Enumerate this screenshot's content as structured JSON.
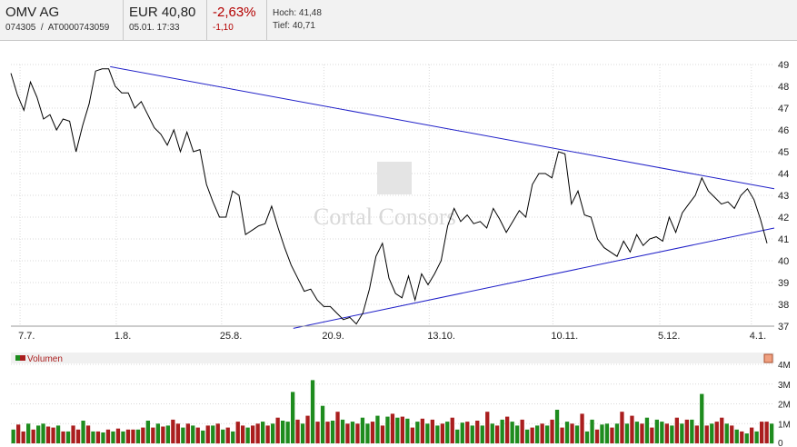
{
  "header": {
    "name": "OMV AG",
    "ids": "074305  /  AT0000743059",
    "price": "EUR 40,80",
    "datetime": "05.01. 17:33",
    "change_pct": "-2,63%",
    "change_abs": "-1,10",
    "high": "Hoch: 41,48",
    "low": "Tief: 40,71"
  },
  "watermark": "Cortal Consors",
  "colors": {
    "price_line": "#000000",
    "trend_line": "#2020c8",
    "vol_up": "#1e8c1e",
    "vol_down": "#aa1e1e",
    "grid": "#d9d9d9",
    "negative": "#b40000"
  },
  "chart_data": [
    {
      "type": "line",
      "x_tick_labels": [
        "7.7.",
        "1.8.",
        "25.8.",
        "20.9.",
        "13.10.",
        "10.11.",
        "5.12.",
        "4.1."
      ],
      "ylim": [
        37,
        49
      ],
      "y_ticks": [
        37,
        38,
        39,
        40,
        41,
        42,
        43,
        44,
        45,
        46,
        47,
        48,
        49
      ],
      "grid": true,
      "series": [
        {
          "values": [
            48.6,
            47.6,
            46.9,
            48.2,
            47.5,
            46.5,
            46.7,
            46.0,
            46.5,
            46.4,
            45.0,
            46.2,
            47.2,
            48.7,
            48.8,
            48.8,
            48.0,
            47.7,
            47.7,
            47.0,
            47.3,
            46.7,
            46.1,
            45.8,
            45.3,
            46.0,
            45.0,
            45.9,
            45.0,
            45.1,
            43.5,
            42.7,
            42.0,
            42.0,
            43.2,
            43.0,
            41.2,
            41.4,
            41.6,
            41.7,
            42.5,
            41.5,
            40.6,
            39.8,
            39.2,
            38.6,
            38.7,
            38.2,
            37.9,
            37.9,
            37.6,
            37.3,
            37.4,
            37.1,
            37.6,
            38.7,
            40.2,
            40.8,
            39.2,
            38.5,
            38.3,
            39.3,
            38.2,
            39.4,
            38.9,
            39.4,
            40.0,
            41.6,
            42.4,
            41.8,
            42.1,
            41.7,
            41.8,
            41.5,
            42.4,
            41.9,
            41.3,
            41.8,
            42.3,
            42.0,
            43.5,
            44.0,
            44.0,
            43.8,
            45.0,
            44.9,
            42.6,
            43.2,
            42.1,
            42.0,
            41.0,
            40.6,
            40.4,
            40.2,
            40.9,
            40.4,
            41.2,
            40.7,
            41.0,
            41.1,
            40.9,
            42.0,
            41.3,
            42.2,
            42.6,
            43.0,
            43.8,
            43.2,
            42.9,
            42.6,
            42.7,
            42.4,
            43.0,
            43.3,
            42.8,
            41.9,
            40.8
          ]
        }
      ],
      "trendlines": [
        {
          "from": [
            48.9,
            0.13
          ],
          "to": [
            43.3,
            1.0
          ]
        },
        {
          "from": [
            36.9,
            0.37
          ],
          "to": [
            41.5,
            1.0
          ]
        }
      ]
    },
    {
      "type": "bar",
      "title": "Volumen",
      "ylim": [
        0,
        4
      ],
      "y_tick_labels": [
        "0",
        "1M",
        "2M",
        "3M",
        "4M"
      ],
      "values": [
        0.7,
        0.95,
        0.6,
        1.0,
        0.7,
        0.9,
        1.0,
        0.85,
        0.8,
        0.9,
        0.6,
        0.6,
        0.9,
        0.7,
        1.15,
        0.9,
        0.6,
        0.6,
        0.55,
        0.7,
        0.6,
        0.75,
        0.6,
        0.7,
        0.7,
        0.7,
        0.8,
        1.15,
        0.8,
        1.0,
        0.85,
        0.9,
        1.2,
        1.0,
        0.8,
        1.0,
        0.9,
        0.8,
        0.65,
        0.9,
        0.9,
        1.0,
        0.7,
        0.8,
        0.6,
        1.1,
        0.9,
        0.8,
        0.9,
        1.0,
        1.1,
        0.9,
        1.0,
        1.3,
        1.15,
        1.1,
        2.6,
        1.2,
        1.0,
        1.4,
        3.2,
        1.1,
        1.9,
        1.1,
        1.15,
        1.6,
        1.2,
        1.0,
        1.1,
        1.0,
        1.3,
        1.0,
        1.1,
        1.4,
        0.9,
        1.35,
        1.5,
        1.3,
        1.35,
        1.25,
        0.8,
        1.1,
        1.25,
        1.0,
        1.2,
        0.9,
        1.0,
        1.1,
        1.3,
        0.7,
        1.05,
        1.1,
        0.9,
        1.15,
        0.9,
        1.6,
        1.0,
        0.9,
        1.2,
        1.35,
        1.1,
        0.9,
        1.2,
        0.7,
        0.8,
        0.9,
        1.0,
        0.9,
        1.2,
        1.7,
        0.8,
        1.1,
        1.0,
        0.9,
        1.5,
        0.6,
        1.2,
        0.7,
        0.95,
        1.0,
        0.8,
        1.0,
        1.6,
        1.0,
        1.4,
        1.1,
        1.0,
        1.3,
        0.8,
        1.2,
        1.1,
        1.0,
        0.9,
        1.3,
        1.0,
        1.2,
        1.2,
        0.9,
        2.5,
        0.9,
        1.0,
        1.1,
        1.3,
        1.0,
        0.9,
        0.7,
        0.6,
        0.5,
        0.8,
        0.6,
        1.1,
        1.1,
        1.0
      ],
      "up": [
        1,
        0,
        0,
        1,
        0,
        1,
        1,
        0,
        0,
        1,
        0,
        1,
        0,
        0,
        1,
        0,
        1,
        0,
        1,
        0,
        1,
        0,
        1,
        0,
        0,
        1,
        0,
        1,
        0,
        1,
        0,
        1,
        0,
        0,
        1,
        0,
        1,
        0,
        1,
        0,
        1,
        0,
        1,
        0,
        1,
        0,
        0,
        1,
        0,
        0,
        1,
        0,
        1,
        0,
        1,
        1,
        1,
        0,
        1,
        0,
        1,
        0,
        1,
        0,
        1,
        0,
        1,
        0,
        1,
        0,
        1,
        1,
        0,
        1,
        0,
        1,
        0,
        1,
        0,
        1,
        0,
        1,
        0,
        1,
        0,
        1,
        0,
        1,
        0,
        1,
        1,
        0,
        1,
        0,
        1,
        0,
        1,
        0,
        1,
        0,
        1,
        1,
        0,
        1,
        0,
        1,
        0,
        1,
        0,
        1,
        0,
        1,
        0,
        1,
        0,
        1,
        1,
        0,
        1,
        1,
        0,
        1,
        0,
        1,
        0,
        1,
        0,
        1,
        0,
        1,
        1,
        0,
        1,
        0,
        1,
        0,
        1,
        0,
        1,
        0,
        1,
        0,
        0,
        1,
        0,
        1,
        0,
        1,
        0,
        1,
        0,
        0,
        1,
        0,
        0,
        0,
        1,
        0,
        1
      ]
    }
  ]
}
